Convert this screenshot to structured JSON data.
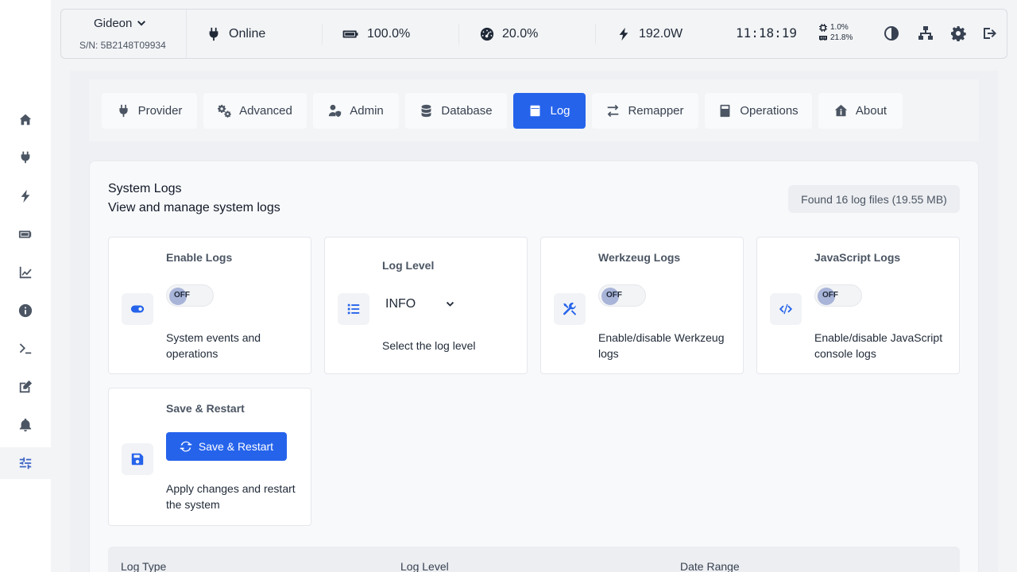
{
  "sidebar": {
    "items": [
      {
        "name": "home-icon",
        "active": false
      },
      {
        "name": "plug-icon",
        "active": false
      },
      {
        "name": "bolt-icon",
        "active": false
      },
      {
        "name": "battery-icon",
        "active": false
      },
      {
        "name": "chart-line-icon",
        "active": false
      },
      {
        "name": "info-icon",
        "active": false
      },
      {
        "name": "terminal-icon",
        "active": false
      },
      {
        "name": "edit-icon",
        "active": false
      },
      {
        "name": "bell-icon",
        "active": false
      },
      {
        "name": "sliders-icon",
        "active": true
      }
    ]
  },
  "header": {
    "device_name": "Gideon",
    "serial": "S/N: 5B2148T09934",
    "status": "Online",
    "battery": "100.0%",
    "load": "20.0%",
    "power": "192.0W",
    "clock": "11:18:19",
    "cpu": "1.0%",
    "memory": "21.8%"
  },
  "tabs": [
    {
      "label": "Provider",
      "icon": "plug-icon",
      "active": false
    },
    {
      "label": "Advanced",
      "icon": "cogs-icon",
      "active": false
    },
    {
      "label": "Admin",
      "icon": "user-shield-icon",
      "active": false
    },
    {
      "label": "Database",
      "icon": "database-icon",
      "active": false
    },
    {
      "label": "Log",
      "icon": "file-icon",
      "active": true
    },
    {
      "label": "Remapper",
      "icon": "exchange-icon",
      "active": false
    },
    {
      "label": "Operations",
      "icon": "calculator-icon",
      "active": false
    },
    {
      "label": "About",
      "icon": "house-info-icon",
      "active": false
    }
  ],
  "panel": {
    "title": "System Logs",
    "subtitle": "View and manage system logs",
    "found": "Found 16 log files (19.55 MB)"
  },
  "cards": {
    "enable_logs": {
      "title": "Enable Logs",
      "toggle": "OFF",
      "desc": "System events and operations"
    },
    "log_level": {
      "title": "Log Level",
      "value": "INFO",
      "desc": "Select the log level"
    },
    "werkzeug": {
      "title": "Werkzeug Logs",
      "toggle": "OFF",
      "desc": "Enable/disable Werkzeug logs"
    },
    "javascript": {
      "title": "JavaScript Logs",
      "toggle": "OFF",
      "desc": "Enable/disable JavaScript console logs"
    },
    "save": {
      "title": "Save & Restart",
      "button": "Save & Restart",
      "desc": "Apply changes and restart the system"
    }
  },
  "filters": {
    "log_type": "Log Type",
    "log_level": "Log Level",
    "date_range": "Date Range"
  },
  "colors": {
    "accent": "#2563eb",
    "background": "#f3f4f6"
  }
}
